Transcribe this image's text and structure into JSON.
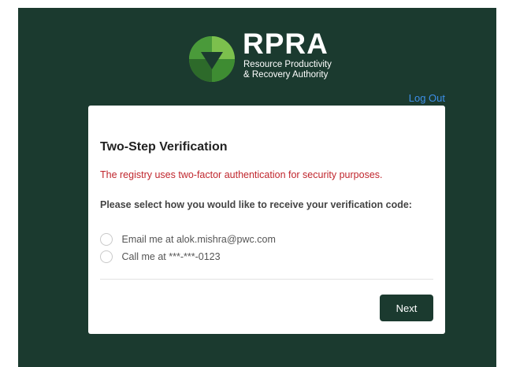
{
  "brand": {
    "acronym": "RPRA",
    "line1": "Resource Productivity",
    "line2": "& Recovery Authority"
  },
  "topbar": {
    "user_link": "",
    "logout_label": "Log Out"
  },
  "card": {
    "title": "Two-Step Verification",
    "notice": "The registry uses two-factor authentication for security purposes.",
    "prompt": "Please select how you would like to receive your verification code:",
    "options": [
      {
        "label": "Email me at alok.mishra@pwc.com",
        "selected": false
      },
      {
        "label": "Call me at ***-***-0123",
        "selected": false
      }
    ],
    "next_label": "Next"
  },
  "colors": {
    "background": "#1b3a2f",
    "notice": "#c0262d",
    "link": "#3d8fe8",
    "button": "#1b3a2f"
  }
}
